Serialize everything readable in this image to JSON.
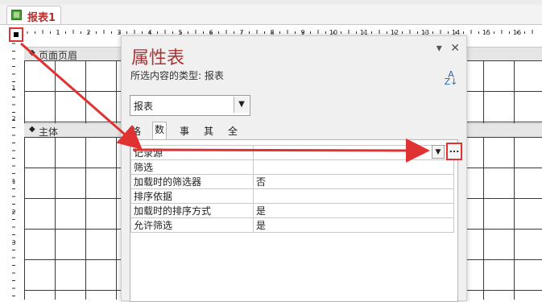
{
  "document_tab": {
    "label": "报表1",
    "icon": "report-icon"
  },
  "ruler": {
    "h_numbers": [
      "1",
      "2",
      "3",
      "4",
      "5",
      "6",
      "7",
      "8",
      "9",
      "10",
      "11",
      "12",
      "13",
      "14",
      "15",
      "16"
    ],
    "v_numbers": [
      "1",
      "2",
      "1",
      "2",
      "3"
    ]
  },
  "sections": {
    "page_header": "页面页眉",
    "detail": "主体"
  },
  "property_sheet": {
    "title": "属性表",
    "selection_type_label": "所选内容的类型: 报表",
    "selector_value": "报表",
    "tabs": [
      "格式",
      "数据",
      "事件",
      "其他",
      "全部"
    ],
    "active_tab": "数据",
    "rows": [
      {
        "name": "记录源",
        "value": ""
      },
      {
        "name": "筛选",
        "value": ""
      },
      {
        "name": "加载时的筛选器",
        "value": "否"
      },
      {
        "name": "排序依据",
        "value": ""
      },
      {
        "name": "加载时的排序方式",
        "value": "是"
      },
      {
        "name": "允许筛选",
        "value": "是"
      }
    ],
    "build_button_label": "..."
  },
  "colors": {
    "annotation": "#e03232",
    "title": "#a33333"
  }
}
